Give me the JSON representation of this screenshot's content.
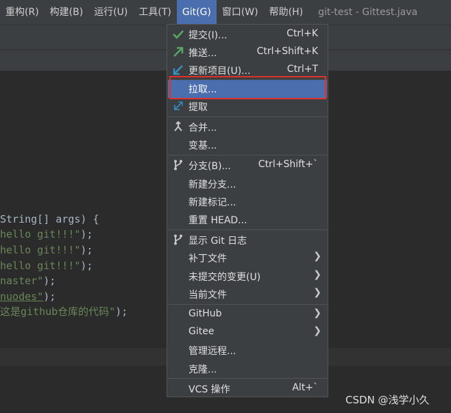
{
  "menubar": {
    "items": [
      "重构(R)",
      "构建(B)",
      "运行(U)",
      "工具(T)",
      "Git(G)",
      "窗口(W)",
      "帮助(H)"
    ],
    "title": "git-test - Gittest.java"
  },
  "editor": {
    "lines": [
      {
        "parts": [
          {
            "t": "String[] args) {",
            "c": "txt"
          }
        ]
      },
      {
        "parts": [
          {
            "t": "hello git!!!\"",
            "c": "str"
          },
          {
            "t": ");",
            "c": "kw"
          }
        ]
      },
      {
        "parts": [
          {
            "t": "hello git!!!\"",
            "c": "str"
          },
          {
            "t": ");",
            "c": "kw"
          }
        ]
      },
      {
        "parts": [
          {
            "t": "hello git!!!\"",
            "c": "str"
          },
          {
            "t": ");",
            "c": "kw"
          }
        ]
      },
      {
        "parts": [
          {
            "t": "naster\"",
            "c": "str"
          },
          {
            "t": ");",
            "c": "kw"
          }
        ]
      },
      {
        "parts": [
          {
            "t": "nuodes\"",
            "c": "str wavy"
          },
          {
            "t": ");",
            "c": "kw"
          }
        ]
      },
      {
        "parts": [
          {
            "t": "这是github仓库的代码\"",
            "c": "str"
          },
          {
            "t": ");",
            "c": "kw"
          }
        ]
      }
    ]
  },
  "git_menu": {
    "commit": {
      "label": "提交(I)...",
      "shortcut": "Ctrl+K"
    },
    "push": {
      "label": "推送...",
      "shortcut": "Ctrl+Shift+K"
    },
    "update": {
      "label": "更新项目(U)...",
      "shortcut": "Ctrl+T"
    },
    "pull": {
      "label": "拉取..."
    },
    "fetch": {
      "label": "提取"
    },
    "merge": {
      "label": "合并..."
    },
    "rebase": {
      "label": "变基..."
    },
    "branches": {
      "label": "分支(B)...",
      "shortcut": "Ctrl+Shift+`"
    },
    "new_branch": {
      "label": "新建分支..."
    },
    "new_tag": {
      "label": "新建标记..."
    },
    "reset_head": {
      "label": "重置 HEAD..."
    },
    "show_log": {
      "label": "显示 Git 日志"
    },
    "patch": {
      "label": "补丁文件"
    },
    "uncommitted": {
      "label": "未提交的变更(U)"
    },
    "current_file": {
      "label": "当前文件"
    },
    "github": {
      "label": "GitHub"
    },
    "gitee": {
      "label": "Gitee"
    },
    "manage_remotes": {
      "label": "管理远程..."
    },
    "clone": {
      "label": "克隆..."
    },
    "vcs_ops": {
      "label": "VCS 操作",
      "shortcut": "Alt+`"
    }
  },
  "colors": {
    "accent": "#4b6eaf",
    "highlight_box": "#e2302b"
  },
  "icons": [
    "check-icon",
    "push-arrow-icon",
    "update-arrow-icon",
    "fetch-arrow-icon",
    "merge-icon",
    "branch-icon",
    "log-icon",
    "chevron-right-icon"
  ],
  "watermark": "CSDN @浅学小久"
}
